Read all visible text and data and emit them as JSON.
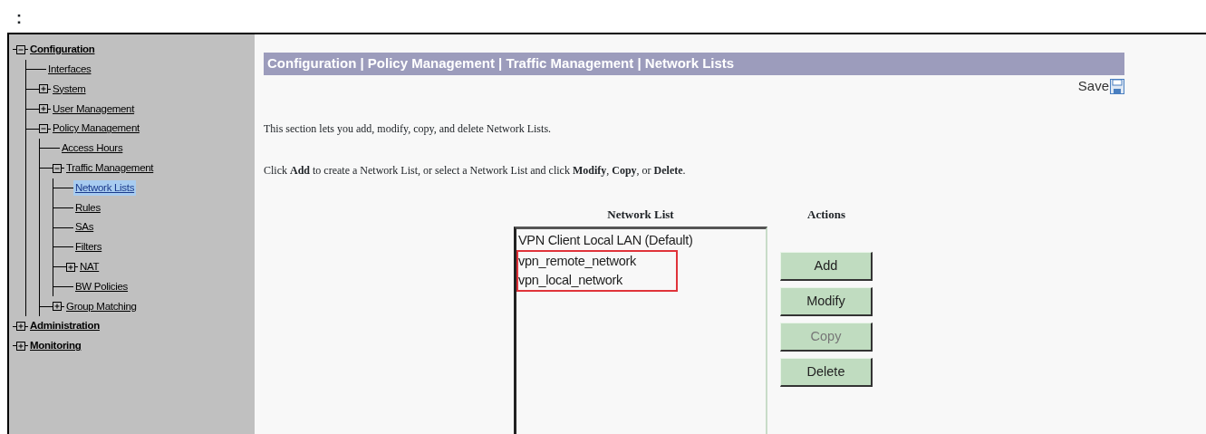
{
  "caption": ":",
  "tree": [
    {
      "label": "Configuration",
      "expanded": true,
      "selected": false,
      "children": [
        {
          "label": "Interfaces",
          "selected": false
        },
        {
          "label": "System",
          "expanded": false,
          "selected": false
        },
        {
          "label": "User Management",
          "expanded": false,
          "selected": false
        },
        {
          "label": "Policy Management",
          "expanded": true,
          "selected": false,
          "children": [
            {
              "label": "Access Hours",
              "selected": false
            },
            {
              "label": "Traffic Management",
              "expanded": true,
              "selected": false,
              "children": [
                {
                  "label": "Network Lists",
                  "selected": true
                },
                {
                  "label": "Rules",
                  "selected": false
                },
                {
                  "label": "SAs",
                  "selected": false
                },
                {
                  "label": "Filters",
                  "selected": false
                },
                {
                  "label": "NAT",
                  "expanded": false,
                  "selected": false
                },
                {
                  "label": "BW Policies",
                  "selected": false
                }
              ]
            },
            {
              "label": "Group Matching",
              "expanded": false,
              "selected": false
            }
          ]
        }
      ]
    },
    {
      "label": "Administration",
      "expanded": false,
      "selected": false
    },
    {
      "label": "Monitoring",
      "expanded": false,
      "selected": false
    }
  ],
  "title_bar": "Configuration | Policy Management | Traffic Management | Network Lists",
  "save": "Save",
  "intro": "This section lets you add, modify, copy, and delete Network Lists.",
  "instructions": "Click **Add** to create a Network List, or select a Network List and click **Modify**, **Copy**, or **Delete**.",
  "list_heading": "Network List",
  "actions_heading": "Actions",
  "network_lists": [
    {
      "label": "VPN Client Local LAN (Default)",
      "outlined": false
    },
    {
      "label": "vpn_remote_network",
      "outlined": true
    },
    {
      "label": "vpn_local_network",
      "outlined": true
    }
  ],
  "buttons": [
    {
      "label": "Add",
      "disabled": false
    },
    {
      "label": "Modify",
      "disabled": false
    },
    {
      "label": "Copy",
      "disabled": true
    },
    {
      "label": "Delete",
      "disabled": false
    }
  ]
}
